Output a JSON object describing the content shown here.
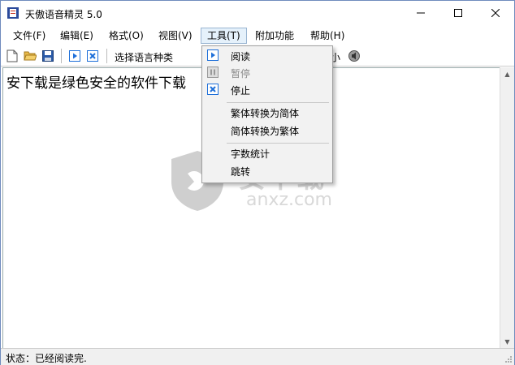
{
  "window": {
    "title": "天傲语音精灵 5.0",
    "controls": {
      "minimize": "—",
      "maximize": "☐",
      "close": "✕"
    }
  },
  "menubar": [
    {
      "label": "文件(F)"
    },
    {
      "label": "编辑(E)"
    },
    {
      "label": "格式(O)"
    },
    {
      "label": "视图(V)"
    },
    {
      "label": "工具(T)"
    },
    {
      "label": "附加功能"
    },
    {
      "label": "帮助(H)"
    }
  ],
  "toolbar": {
    "icons": [
      "new-file-icon",
      "open-folder-icon",
      "save-icon",
      "play-icon",
      "stop-icon"
    ],
    "language_label": "选择语言种类",
    "partial_label": "小",
    "speaker_icon": "speaker-icon"
  },
  "tools_menu": {
    "items": [
      {
        "label": "阅读",
        "icon": "play-icon",
        "enabled": true
      },
      {
        "label": "暂停",
        "icon": "pause-icon",
        "enabled": false
      },
      {
        "label": "停止",
        "icon": "stop-icon",
        "enabled": true
      },
      {
        "label": "繁体转换为简体",
        "enabled": true
      },
      {
        "label": "简体转换为繁体",
        "enabled": true
      },
      {
        "label": "字数统计",
        "enabled": true
      },
      {
        "label": "跳转",
        "enabled": true
      }
    ]
  },
  "editor": {
    "content": "安下载是绿色安全的软件下载"
  },
  "statusbar": {
    "text": "状态：已经阅读完."
  },
  "watermark": {
    "cn": "安下载",
    "en": "anxz.com"
  },
  "colors": {
    "accent": "#1e6fd9",
    "stop_red": "#c42b1c",
    "menu_highlight": "#e5f1fb"
  }
}
